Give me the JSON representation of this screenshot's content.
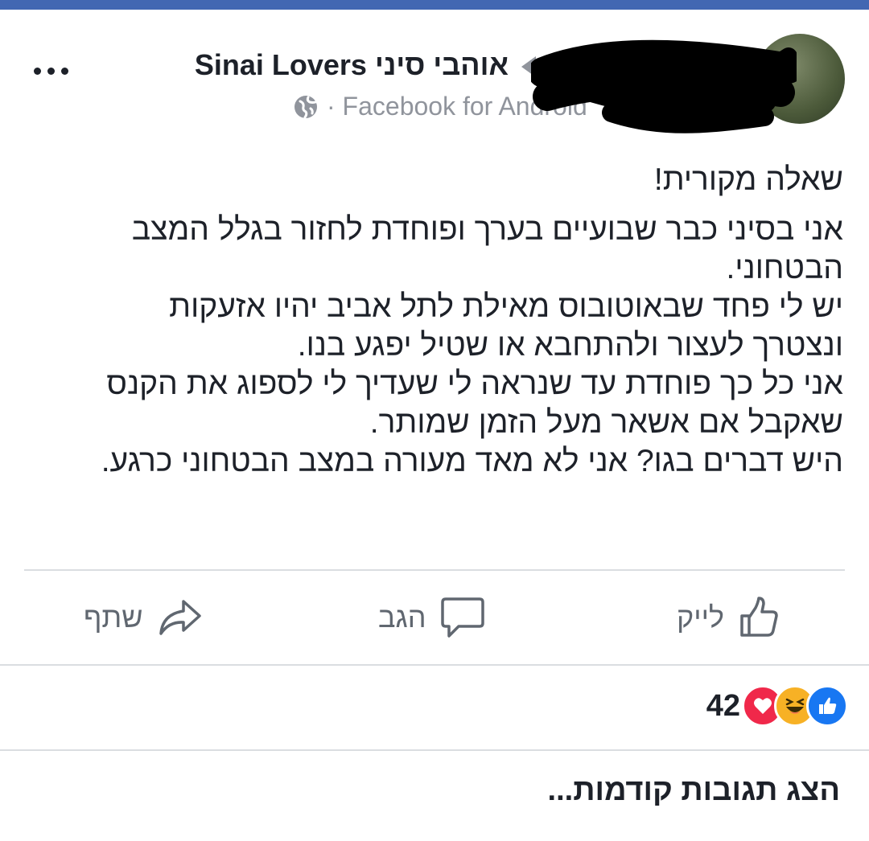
{
  "post": {
    "group_name": "Sinai Lovers אוהבי סיני",
    "source": "· Facebook for Android",
    "text": {
      "title": "שאלה מקורית!",
      "lines": [
        "אני בסיני כבר שבועיים בערך ופוחדת לחזור בגלל המצב",
        "הבטחוני.",
        "יש לי פחד שבאוטובוס מאילת לתל אביב יהיו אזעקות",
        "ונצטרך לעצור ולהתחבא או שטיל יפגע בנו.",
        "אני כל כך פוחדת עד שנראה לי שעדיך לי לספוג את הקנס",
        "שאקבל אם אשאר מעל הזמן שמותר.",
        "היש דברים בגו? אני לא מאד מעורה במצב הבטחוני כרגע."
      ]
    }
  },
  "actions": {
    "like": "לייק",
    "comment": "הגב",
    "share": "שתף"
  },
  "reactions": {
    "count": "42",
    "types": [
      "like",
      "haha",
      "love"
    ]
  },
  "comments": {
    "show_previous": "הצג תגובות קודמות..."
  },
  "colors": {
    "brand": "#4267b2",
    "like_blue": "#1877f2",
    "love_red": "#f0284a",
    "haha_yellow": "#f7b125",
    "secondary_text": "#90949c",
    "action_text": "#606770"
  }
}
